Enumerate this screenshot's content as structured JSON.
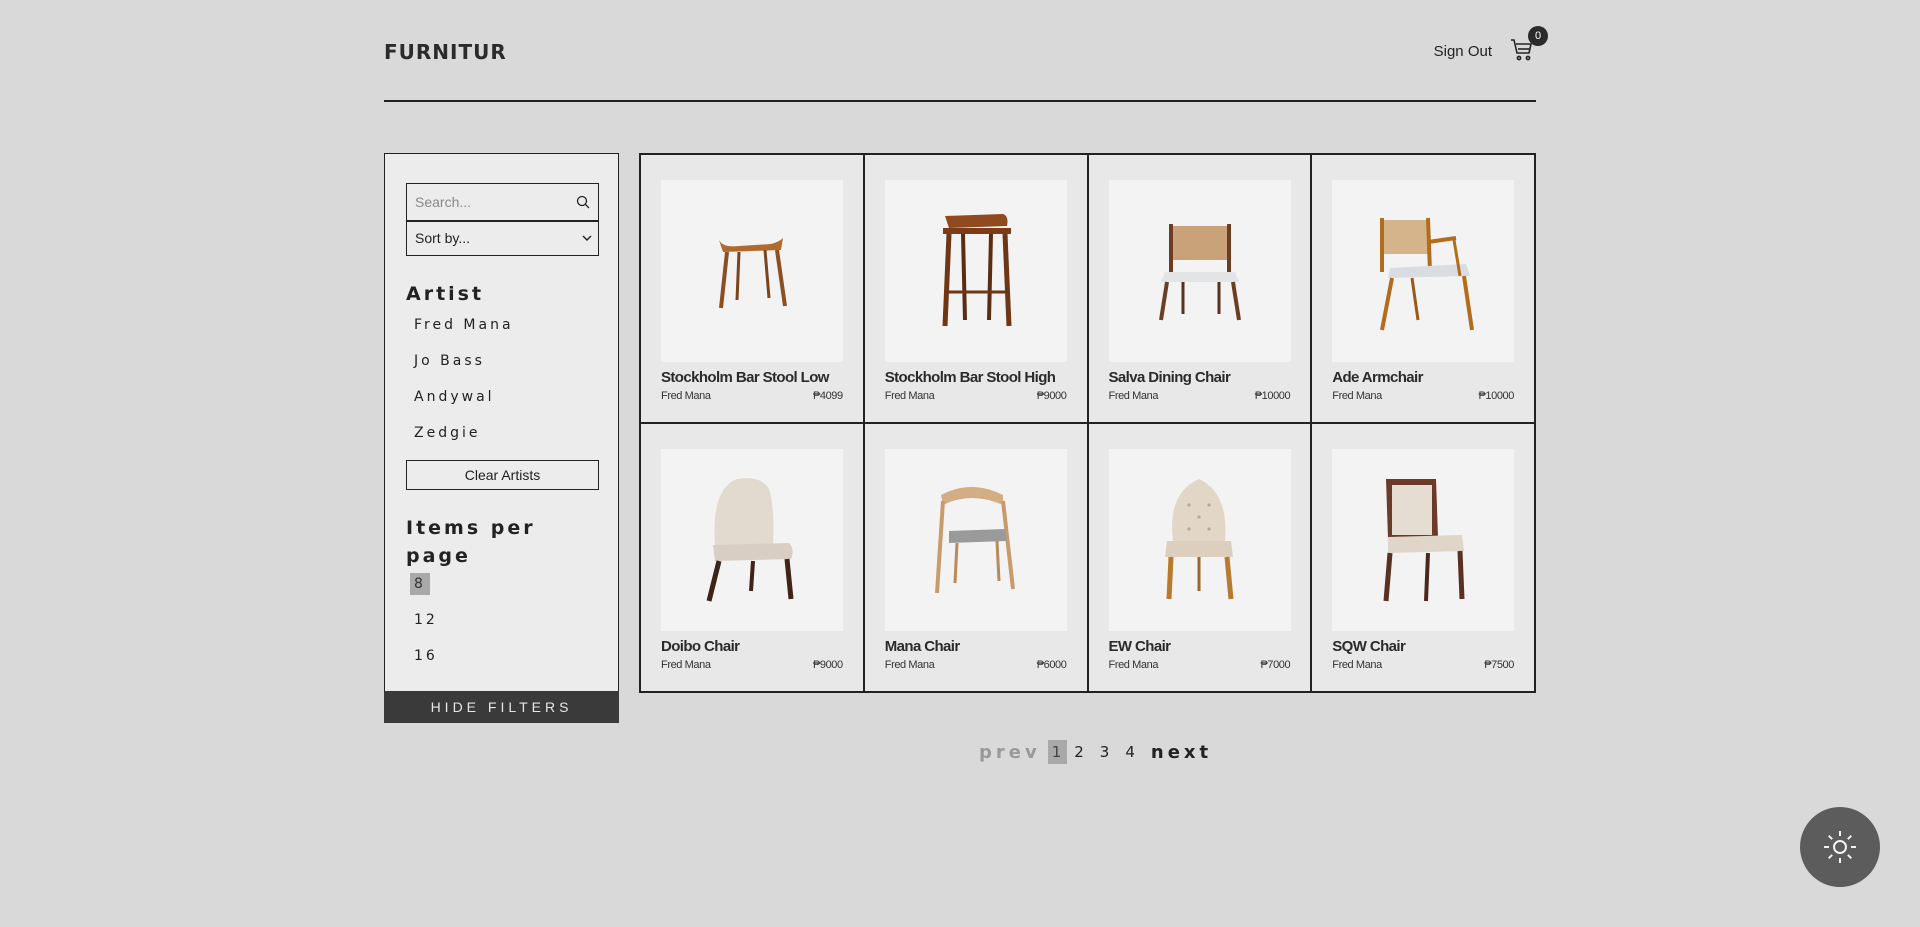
{
  "header": {
    "logo": "FURNITUR",
    "sign_out": "Sign Out",
    "cart_count": "0"
  },
  "filters": {
    "search_placeholder": "Search...",
    "sort_label": "Sort by...",
    "artist_heading": "Artist",
    "artists": [
      "Fred Mana",
      "Jo Bass",
      "Andywal",
      "Zedgie"
    ],
    "clear_artists": "Clear Artists",
    "per_page_heading_1": "Items per",
    "per_page_heading_2": "page",
    "per_page_options": [
      "8",
      "12",
      "16"
    ],
    "per_page_selected": "8",
    "hide_filters": "HIDE FILTERS"
  },
  "products": [
    {
      "name": "Stockholm Bar Stool Low",
      "artist": "Fred Mana",
      "price": "₱4099",
      "icon": "low-bar-stool-image"
    },
    {
      "name": "Stockholm Bar Stool High",
      "artist": "Fred Mana",
      "price": "₱9000",
      "icon": "high-bar-stool-image"
    },
    {
      "name": "Salva Dining Chair",
      "artist": "Fred Mana",
      "price": "₱10000",
      "icon": "dining-chair-image"
    },
    {
      "name": "Ade Armchair",
      "artist": "Fred Mana",
      "price": "₱10000",
      "icon": "armchair-image"
    },
    {
      "name": "Doibo Chair",
      "artist": "Fred Mana",
      "price": "₱9000",
      "icon": "upholstered-chair-image"
    },
    {
      "name": "Mana Chair",
      "artist": "Fred Mana",
      "price": "₱6000",
      "icon": "wooden-chair-image"
    },
    {
      "name": "EW Chair",
      "artist": "Fred Mana",
      "price": "₱7000",
      "icon": "tufted-chair-image"
    },
    {
      "name": "SQW Chair",
      "artist": "Fred Mana",
      "price": "₱7500",
      "icon": "padded-chair-image"
    }
  ],
  "pagination": {
    "prev": "prev",
    "pages": [
      "1",
      "2",
      "3",
      "4"
    ],
    "current": "1",
    "next": "next"
  },
  "theme_toggle": {
    "icon": "sun-icon"
  },
  "colors": {
    "background": "#d9d9d9",
    "panel": "#ececec",
    "dark": "#3a3a3a",
    "active": "#a9a9a9"
  }
}
